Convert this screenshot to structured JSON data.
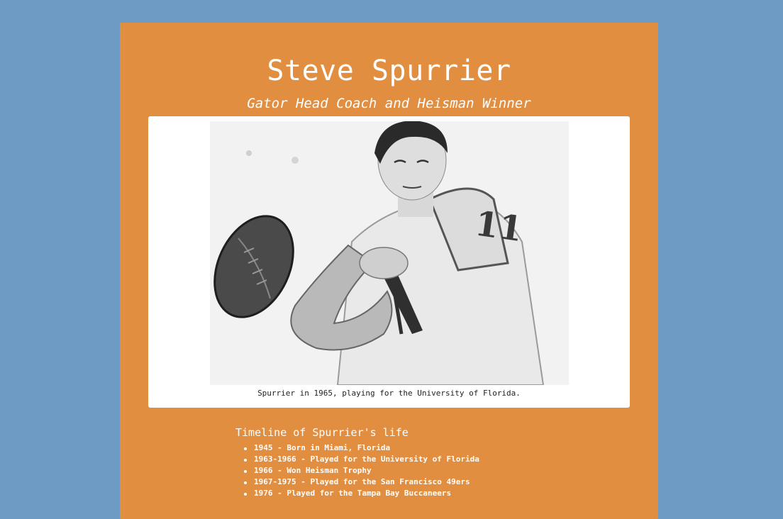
{
  "header": {
    "title": "Steve Spurrier",
    "subtitle": "Gator Head Coach and Heisman Winner"
  },
  "figure": {
    "photo_subject": "black-and-white photo of quarterback in jersey number 11 holding a football",
    "caption": "Spurrier in 1965, playing for the University of Florida."
  },
  "timeline": {
    "heading": "Timeline of Spurrier's life",
    "items": [
      {
        "year": "1945",
        "text": " - Born in Miami, Florida"
      },
      {
        "year": "1963-1966",
        "text": " - Played for the University of Florida"
      },
      {
        "year": "1966",
        "text": " - Won Heisman Trophy"
      },
      {
        "year": "1967-1975",
        "text": " - Played for the San Francisco 49ers"
      },
      {
        "year": "1976",
        "text": " - Played for the Tampa Bay Buccaneers"
      }
    ]
  },
  "colors": {
    "background": "#6d9bc3",
    "card": "#e28e40",
    "text": "#ffffff"
  }
}
